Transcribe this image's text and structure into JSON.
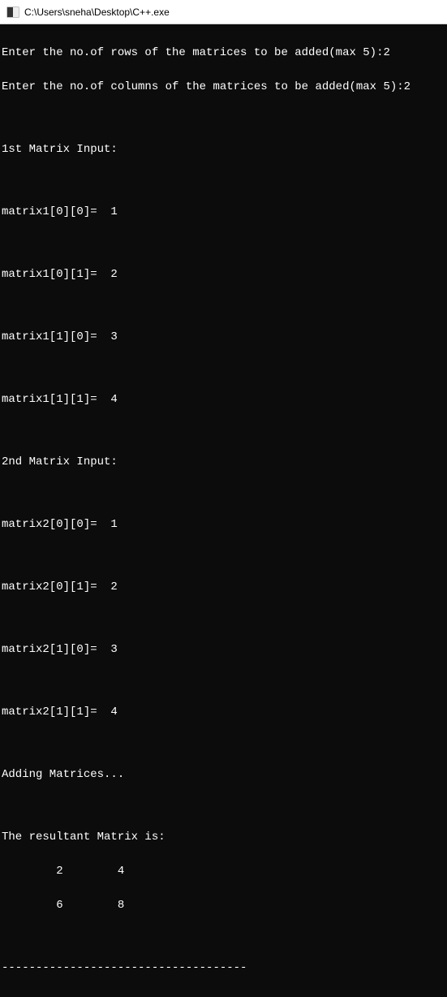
{
  "window": {
    "title": "C:\\Users\\sneha\\Desktop\\C++.exe"
  },
  "console": {
    "prompt_rows": "Enter the no.of rows of the matrices to be added(max 5):2",
    "prompt_cols": "Enter the no.of columns of the matrices to be added(max 5):2",
    "blank": "",
    "input1_header": "1st Matrix Input:",
    "m1_00": "matrix1[0][0]=  1",
    "m1_01": "matrix1[0][1]=  2",
    "m1_10": "matrix1[1][0]=  3",
    "m1_11": "matrix1[1][1]=  4",
    "input2_header": "2nd Matrix Input:",
    "m2_00": "matrix2[0][0]=  1",
    "m2_01": "matrix2[0][1]=  2",
    "m2_10": "matrix2[1][0]=  3",
    "m2_11": "matrix2[1][1]=  4",
    "adding": "Adding Matrices...",
    "result_header": "The resultant Matrix is:",
    "result_row1": "        2        4",
    "result_row2": "        6        8",
    "separator": "------------------------------------"
  }
}
